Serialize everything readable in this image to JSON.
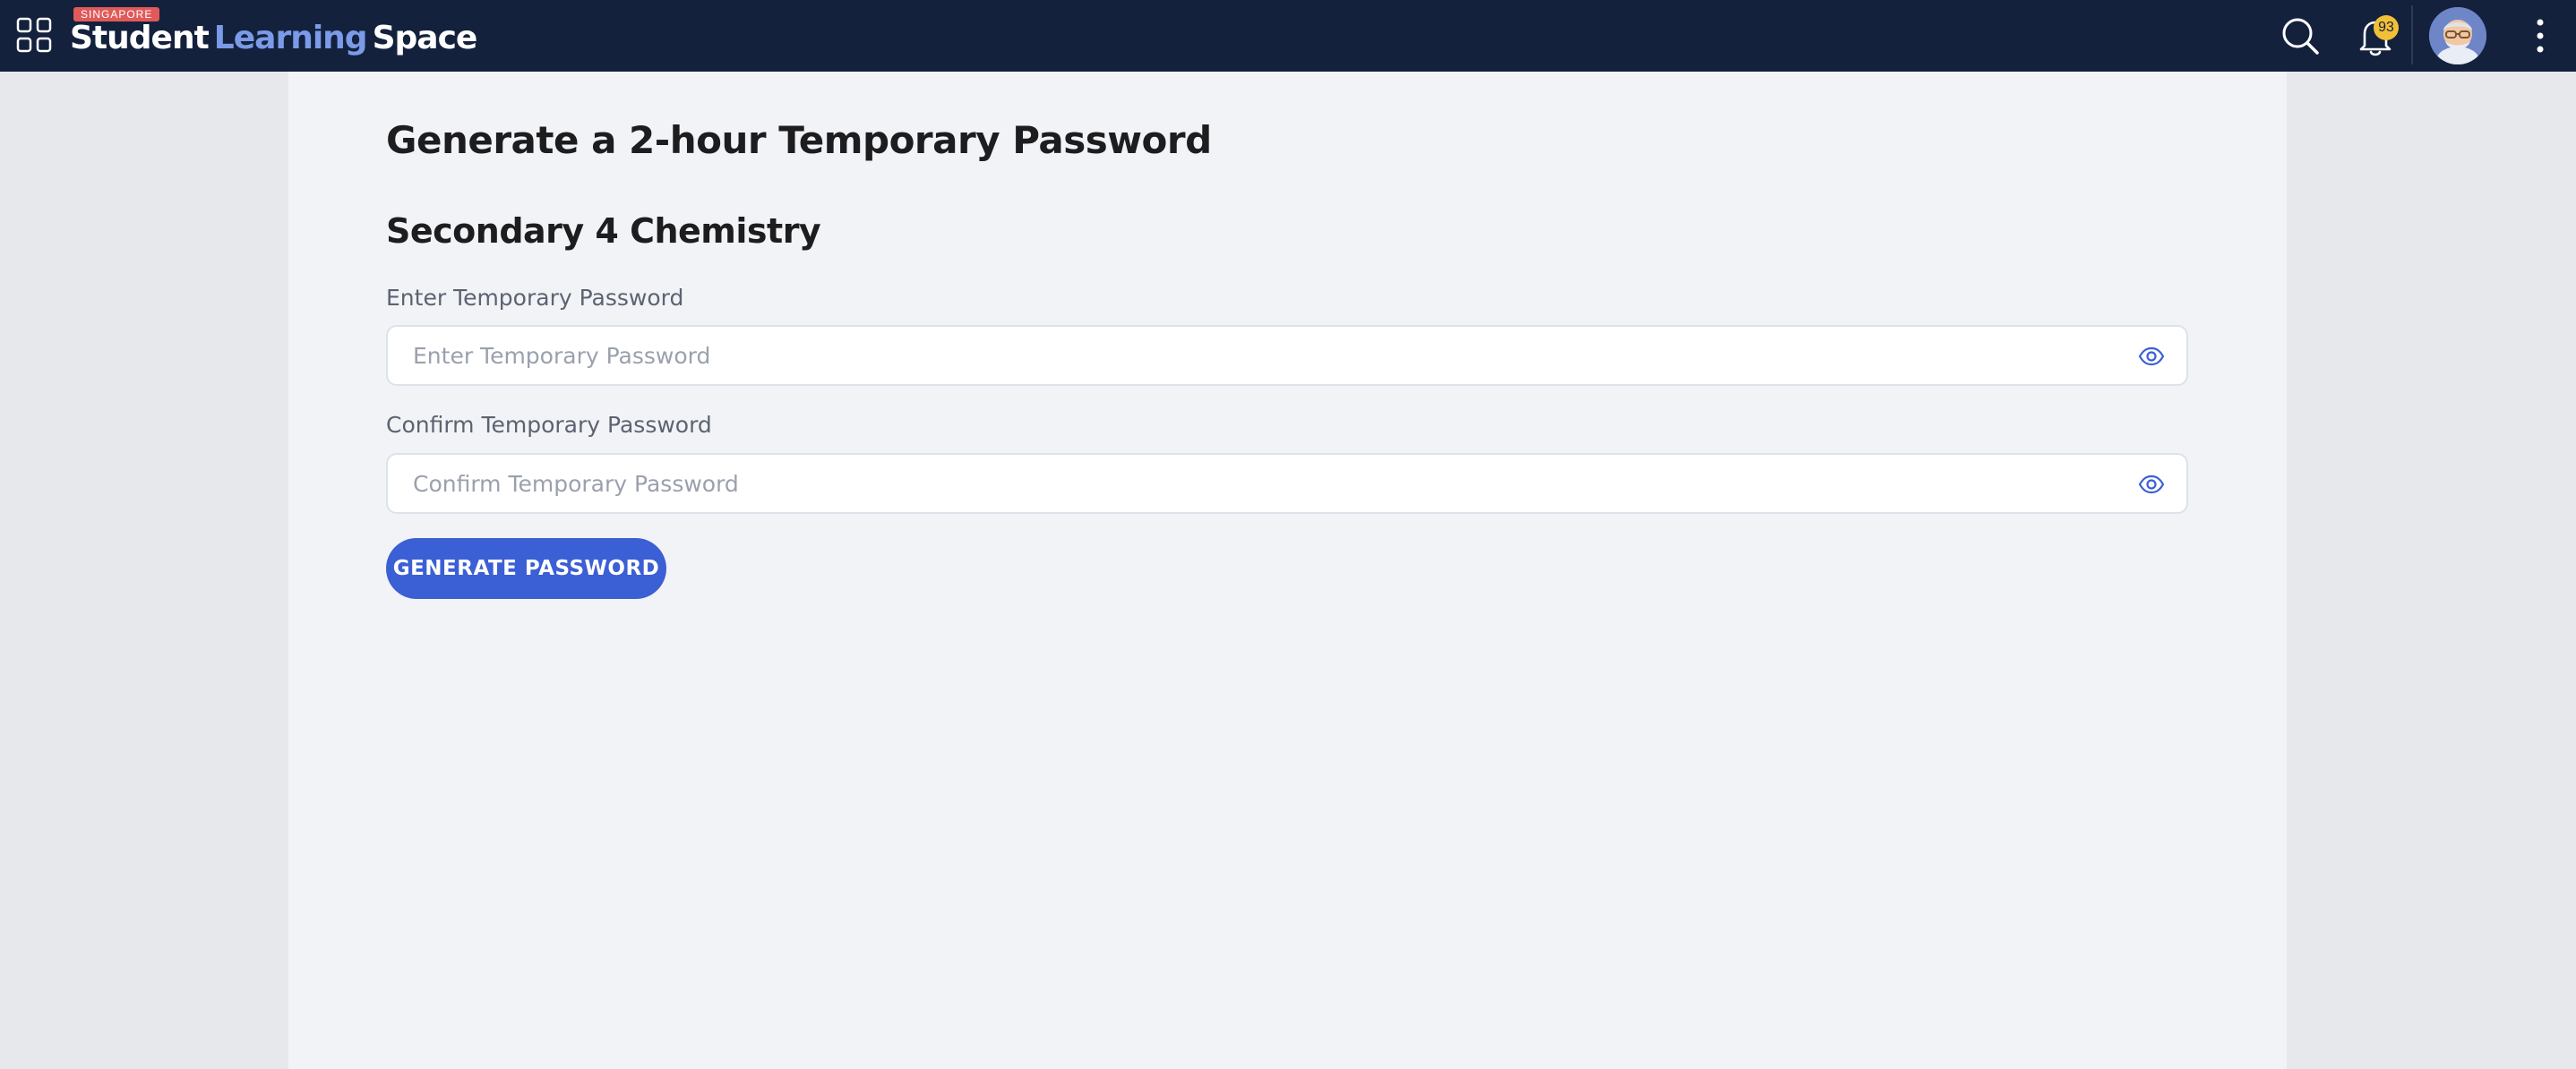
{
  "header": {
    "logo_badge": "SINGAPORE",
    "logo_word1": "Student",
    "logo_word2": "Learning",
    "logo_word3": "Space",
    "notification_count": "93",
    "colors": {
      "bar": "#14213d",
      "accent": "#7b9be8",
      "badge": "#f2c037"
    },
    "icons": [
      "apps-grid-icon",
      "search-icon",
      "bell-icon",
      "avatar",
      "more-vertical-icon"
    ]
  },
  "main": {
    "page_title": "Generate a 2-hour Temporary Password",
    "section_title": "Secondary 4 Chemistry",
    "fields": [
      {
        "label": "Enter Temporary Password",
        "placeholder": "Enter Temporary Password",
        "value": ""
      },
      {
        "label": "Confirm Temporary Password",
        "placeholder": "Confirm Temporary Password",
        "value": ""
      }
    ],
    "generate_button": "GENERATE PASSWORD",
    "colors": {
      "button": "#3b5fd4",
      "eye_icon": "#3b5fd4"
    }
  }
}
